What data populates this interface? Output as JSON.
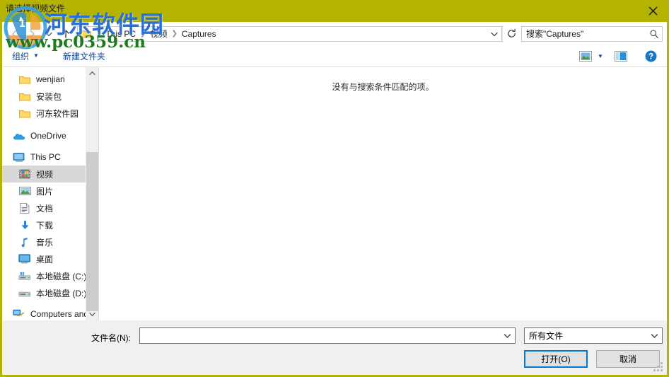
{
  "window": {
    "title": "请选择视频文件",
    "close_icon": "close-icon",
    "titlebar_color": "#b4b400"
  },
  "navbar": {
    "back_icon": "back-arrow-icon",
    "forward_icon": "forward-arrow-icon",
    "recent_icon": "chevron-down-icon",
    "up_icon": "up-arrow-icon",
    "address_folder_icon": "folder-icon",
    "breadcrumbs": [
      "This PC",
      "视频",
      "Captures"
    ],
    "breadcrumb_separator": "❯",
    "address_dropdown_icon": "chevron-down-icon",
    "refresh_icon": "refresh-icon",
    "refresh_glyph": "↻"
  },
  "search": {
    "placeholder": "搜索\"Captures\"",
    "value": "",
    "icon": "search-icon"
  },
  "toolbar": {
    "organize_label": "组织",
    "organize_caret": "▼",
    "new_folder_label": "新建文件夹",
    "view_icon": "view-layout-icon",
    "view_caret": "▼",
    "preview_pane_icon": "preview-pane-icon",
    "help_icon": "help-icon",
    "help_glyph": "?"
  },
  "sidebar": {
    "items": [
      {
        "label": "wenjian",
        "icon": "folder-icon",
        "level": 2,
        "selected": false
      },
      {
        "label": "安装包",
        "icon": "folder-icon",
        "level": 2,
        "selected": false
      },
      {
        "label": "河东软件园",
        "icon": "folder-icon",
        "level": 2,
        "selected": false
      },
      {
        "label": "OneDrive",
        "icon": "onedrive-cloud-icon",
        "level": 1,
        "selected": false
      },
      {
        "label": "This PC",
        "icon": "this-pc-monitor-icon",
        "level": 1,
        "selected": false
      },
      {
        "label": "视频",
        "icon": "videos-icon",
        "level": 2,
        "selected": true
      },
      {
        "label": "图片",
        "icon": "pictures-icon",
        "level": 2,
        "selected": false
      },
      {
        "label": "文档",
        "icon": "documents-icon",
        "level": 2,
        "selected": false
      },
      {
        "label": "下载",
        "icon": "downloads-arrow-icon",
        "level": 2,
        "selected": false
      },
      {
        "label": "音乐",
        "icon": "music-note-icon",
        "level": 2,
        "selected": false
      },
      {
        "label": "桌面",
        "icon": "desktop-icon",
        "level": 2,
        "selected": false
      },
      {
        "label": "本地磁盘 (C:)",
        "icon": "system-drive-icon",
        "level": 2,
        "selected": false
      },
      {
        "label": "本地磁盘 (D:)",
        "icon": "drive-icon",
        "level": 2,
        "selected": false
      },
      {
        "label": "Computers and",
        "icon": "network-icon",
        "level": 1,
        "selected": false
      }
    ],
    "scroll_up_glyph": "︿",
    "scroll_down_glyph": "﹀"
  },
  "filelist": {
    "empty_message": "没有与搜索条件匹配的项。"
  },
  "form": {
    "filename_label": "文件名(N):",
    "filename_value": "",
    "filename_caret": "﹀",
    "filter_value": "所有文件",
    "filter_caret": "﹀",
    "open_button": "打开(O)",
    "cancel_button": "取消",
    "focus_color": "#0078d7"
  },
  "watermark": {
    "site_name": "河东软件园",
    "site_url": "www.pc0359.cn",
    "name_color": "#2a6fd6",
    "url_color": "#1f7a1f"
  }
}
